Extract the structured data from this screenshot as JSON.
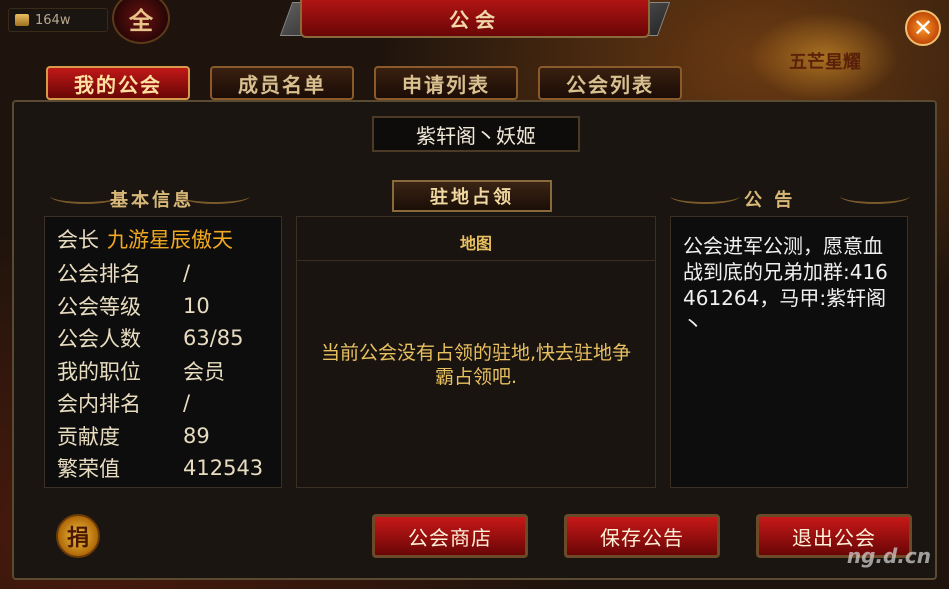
{
  "topbar": {
    "gold": "164w",
    "quan_label": "全",
    "title": "公会",
    "close_label": "✕",
    "promo_text": "五芒星耀"
  },
  "tabs": [
    {
      "label": "我的公会",
      "active": true
    },
    {
      "label": "成员名单",
      "active": false
    },
    {
      "label": "申请列表",
      "active": false
    },
    {
      "label": "公会列表",
      "active": false
    }
  ],
  "guild_name": "紫轩阁丶妖姬",
  "sections": {
    "basic": "基本信息",
    "occupy": "驻地占领",
    "notice": "公  告"
  },
  "basic_info": {
    "leader_label": "会长",
    "leader_value": "九游星辰傲天",
    "rows": [
      {
        "k": "公会排名",
        "v": "/"
      },
      {
        "k": "公会等级",
        "v": "10"
      },
      {
        "k": "公会人数",
        "v": "63/85"
      },
      {
        "k": "我的职位",
        "v": "会员"
      },
      {
        "k": "会内排名",
        "v": "/"
      },
      {
        "k": "贡献度",
        "v": "89"
      },
      {
        "k": "繁荣值",
        "v": "412543"
      }
    ]
  },
  "map": {
    "caption": "地图",
    "message": "当前公会没有占领的驻地,快去驻地争霸占领吧."
  },
  "notice_text": "公会进军公测，愿意血战到底的兄弟加群:416461264，马甲:紫轩阁丶",
  "buttons": {
    "donate": "捐",
    "shop": "公会商店",
    "save": "保存公告",
    "quit": "退出公会"
  },
  "watermark": "ng.d.cn"
}
